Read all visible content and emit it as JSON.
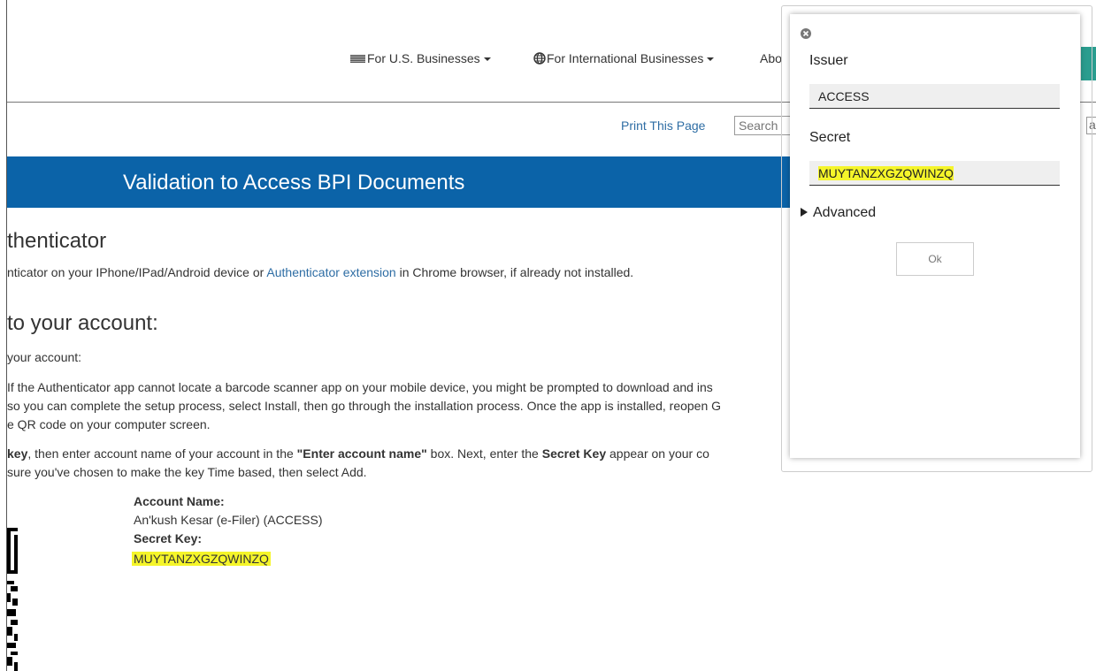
{
  "nav": {
    "us_businesses": "For U.S. Businesses",
    "intl_businesses": "For International Businesses",
    "about_partial": "Abo"
  },
  "utility": {
    "print": "Print This Page",
    "search_placeholder": "Search",
    "search_tail": "a"
  },
  "banner": {
    "title": "Validation to Access BPI Documents"
  },
  "content": {
    "step1_heading": "thenticator",
    "step1_text_before": "nticator on your IPhone/IPad/Android device or ",
    "step1_link": "Authenticator extension",
    "step1_text_after": " in Chrome browser, if already not installed.",
    "step2_heading": "to your account:",
    "step2_intro": "your account:",
    "step2_p1_l1": "If the Authenticator app cannot locate a barcode scanner app on your mobile device, you might be prompted to download and ins",
    "step2_p1_l2": "so you can complete the setup process, select Install, then go through the installation process. Once the app is installed, reopen G",
    "step2_p1_l3": "e QR code on your computer screen.",
    "step2_p2_b1": "key",
    "step2_p2_t1": ", then enter account name of your account in the ",
    "step2_p2_b2": "\"Enter account name\"",
    "step2_p2_t2": " box. Next, enter the ",
    "step2_p2_b3": "Secret Key",
    "step2_p2_t3": " appear on your co",
    "step2_p2_l2": "sure you've chosen to make the key Time based, then select Add.",
    "account_name_label": "Account Name:",
    "account_name_value": "An'kush Kesar (e-Filer) (ACCESS)",
    "secret_key_label": "Secret Key:",
    "secret_key_value": "MUYTANZXGZQWINZQ"
  },
  "popup": {
    "issuer_label": "Issuer",
    "issuer_value": "ACCESS",
    "secret_label": "Secret",
    "secret_value": "MUYTANZXGZQWINZQ",
    "advanced_label": "Advanced",
    "ok_label": "Ok"
  },
  "colors": {
    "banner": "#0b63a8",
    "link": "#2e6da4",
    "highlight": "#f5f52a",
    "accent_button": "#2a9d8f"
  },
  "icons": [
    "flag-icon",
    "globe-icon",
    "caret-down-icon",
    "close-icon",
    "triangle-right-icon"
  ]
}
